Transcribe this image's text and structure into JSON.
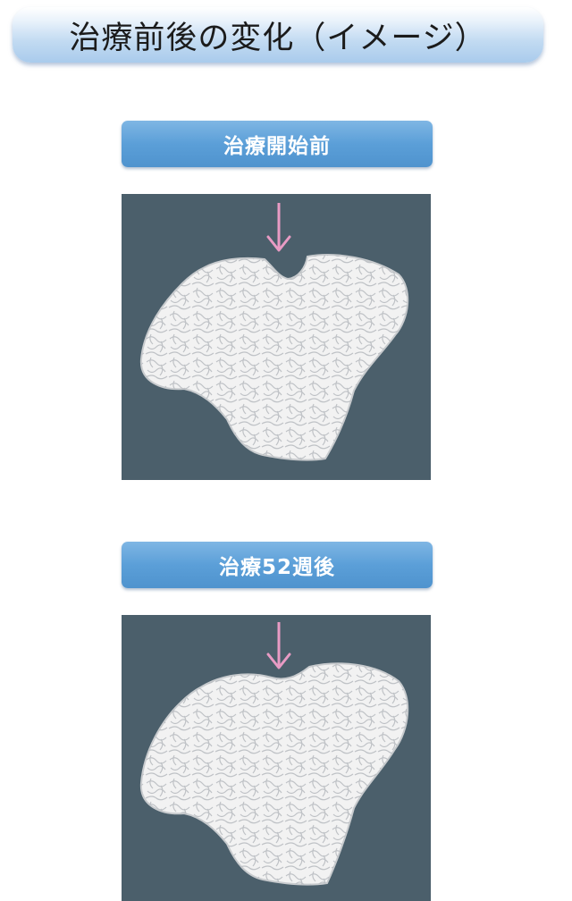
{
  "title": "治療前後の変化（イメージ）",
  "panels": [
    {
      "label": "治療開始前",
      "arrow_color": "#e89bc4",
      "bone_color": "#f2f2f2",
      "background": "#4b5f6b"
    },
    {
      "label": "治療52週後",
      "arrow_color": "#e89bc4",
      "bone_color": "#f2f2f2",
      "background": "#4b5f6b"
    }
  ]
}
